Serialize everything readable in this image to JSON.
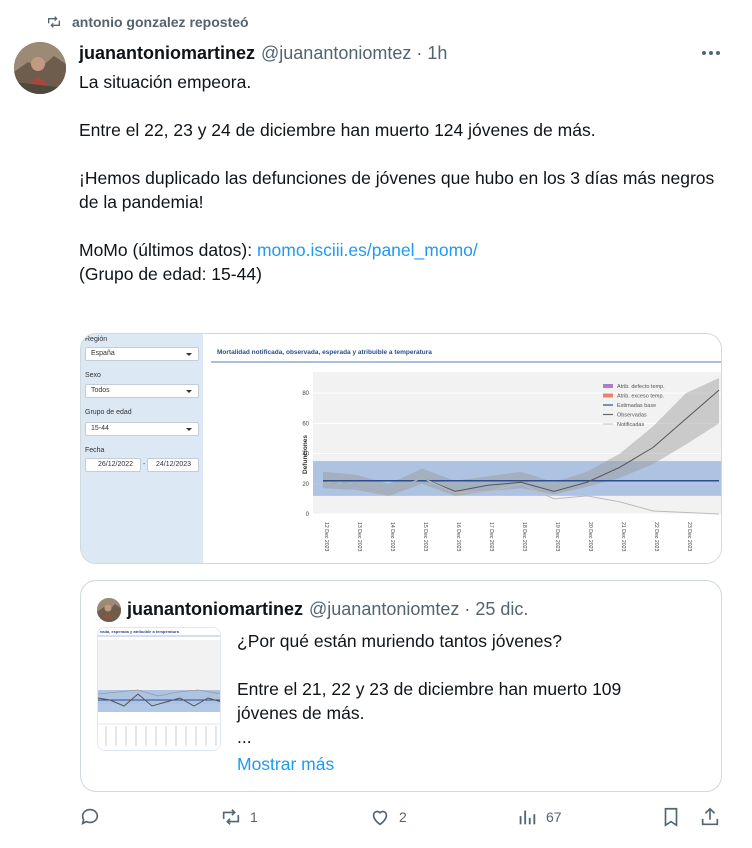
{
  "repost": {
    "text": "antonio gonzalez reposteó"
  },
  "tweet": {
    "name": "juanantoniomartinez",
    "handle": "@juanantoniomtez · 1h",
    "lines": [
      "La situación empeora.",
      "Entre el 22, 23 y 24 de diciembre han muerto 124 jóvenes de más.",
      "¡Hemos duplicado las defunciones de jóvenes que hubo en los 3 días más negros de la pandemia!",
      "MoMo (últimos datos): ",
      "(Grupo de edad: 15-44)"
    ],
    "link": "momo.isciii.es/panel_momo/"
  },
  "media": {
    "filters": {
      "region_label": "Región",
      "region_value": "España",
      "sexo_label": "Sexo",
      "sexo_value": "Todos",
      "grupo_label": "Grupo de edad",
      "grupo_value": "15-44",
      "fecha_label": "Fecha",
      "fecha_from": "26/12/2022",
      "fecha_sep": "-",
      "fecha_to": "24/12/2023"
    }
  },
  "chart_data": {
    "type": "line",
    "title": "Mortalidad notificada, observada, esperada y atribuible a temperatura",
    "ylabel": "Defunciones",
    "xlabel": "",
    "ylim": [
      0,
      90
    ],
    "yticks": [
      0,
      20,
      40,
      60,
      80
    ],
    "categories": [
      "12 Dec 2023",
      "13 Dec 2023",
      "14 Dec 2023",
      "15 Dec 2023",
      "16 Dec 2023",
      "17 Dec 2023",
      "18 Dec 2023",
      "19 Dec 2023",
      "20 Dec 2023",
      "21 Dec 2023",
      "22 Dec 2023",
      "23 Dec 2023",
      "24 Dec 2023"
    ],
    "legend": [
      "Atrib. defecto temp.",
      "Atrib. exceso temp.",
      "Estimadas base",
      "Observadas",
      "Notificadas"
    ],
    "legend_colors": [
      "#b07cc6",
      "#e8846c",
      "#2b4d8c",
      "#666666",
      "#cccccc"
    ],
    "series": [
      {
        "name": "Estimadas base",
        "values": [
          22,
          22,
          22,
          22,
          22,
          22,
          22,
          22,
          22,
          22,
          22,
          22,
          22
        ]
      },
      {
        "name": "Observadas",
        "values": [
          21,
          20,
          14,
          24,
          15,
          19,
          21,
          15,
          21,
          31,
          44,
          63,
          82
        ]
      },
      {
        "name": "Notificadas",
        "values": [
          21,
          20,
          14,
          24,
          14,
          15,
          20,
          10,
          12,
          8,
          2,
          1,
          0
        ]
      }
    ],
    "band_base": [
      12,
      35
    ],
    "band_obs_low": [
      17,
      16,
      12,
      20,
      12,
      15,
      17,
      13,
      18,
      24,
      33,
      46,
      60
    ],
    "band_obs_high": [
      28,
      26,
      20,
      30,
      22,
      25,
      28,
      21,
      28,
      40,
      58,
      80,
      90
    ]
  },
  "quote": {
    "name": "juanantoniomartinez",
    "handle": "@juanantoniomtez · 25 dic.",
    "lines": [
      "¿Por qué están muriendo tantos jóvenes?",
      "Entre el 21, 22 y 23 de diciembre han muerto 109",
      "jóvenes de más.",
      "..."
    ],
    "more": "Mostrar más",
    "thumb_title": "vada, esperada y atribuible a temperatura"
  },
  "actions": {
    "reply": "",
    "repost": "1",
    "like": "2",
    "views": "67"
  }
}
